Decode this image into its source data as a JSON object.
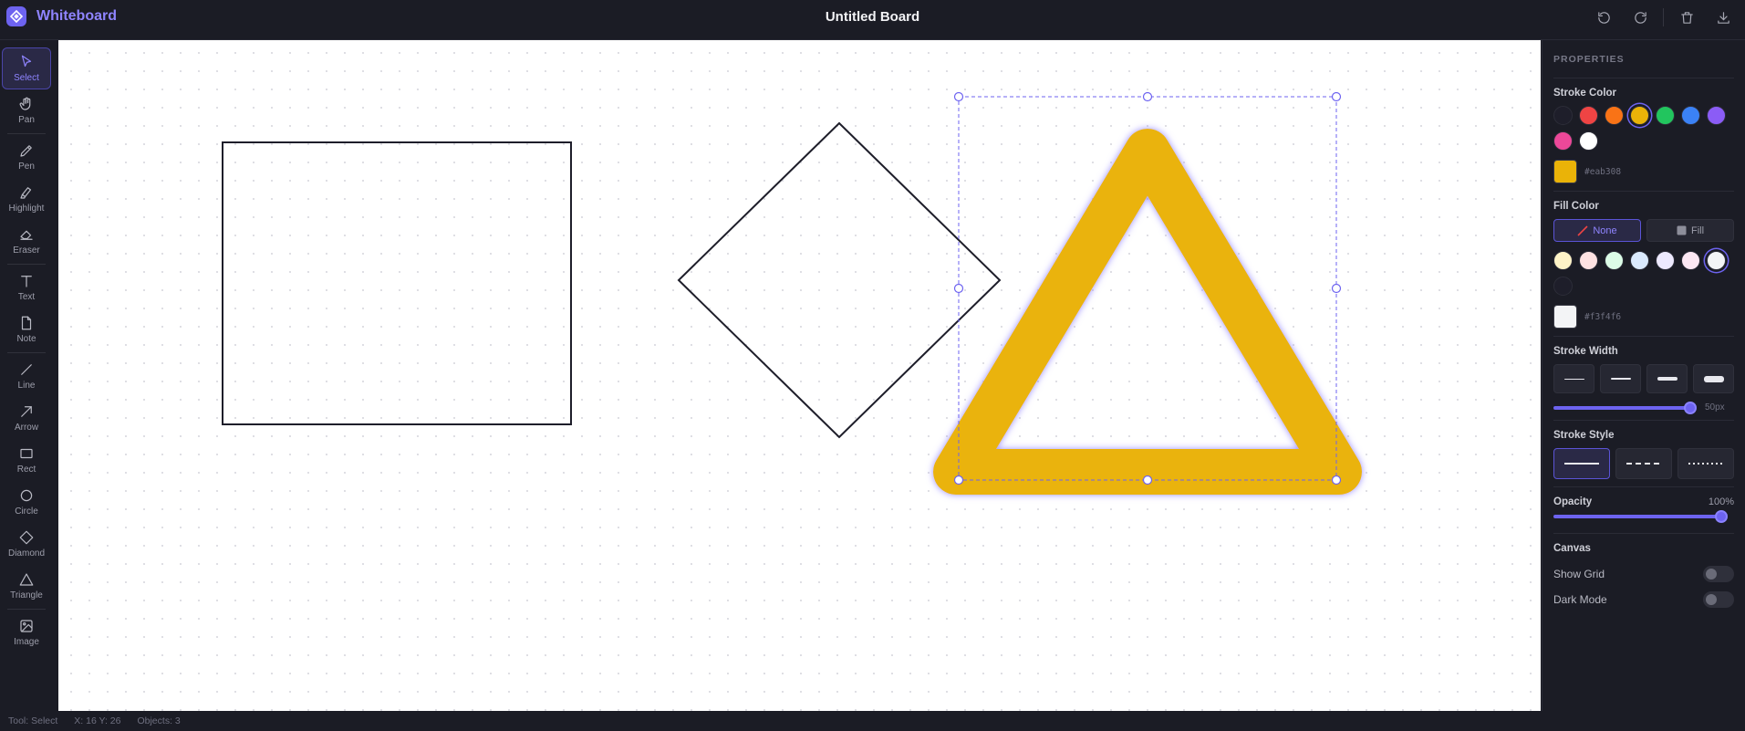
{
  "app": {
    "name": "Whiteboard"
  },
  "board": {
    "title": "Untitled Board"
  },
  "toolbar": {
    "tools": [
      {
        "label": "Select",
        "icon": "cursor-icon",
        "active": true
      },
      {
        "label": "Pan",
        "icon": "hand-icon"
      },
      {
        "label": "Pen",
        "icon": "pen-icon"
      },
      {
        "label": "Highlight",
        "icon": "highlighter-icon"
      },
      {
        "label": "Eraser",
        "icon": "eraser-icon"
      },
      {
        "label": "Text",
        "icon": "text-icon"
      },
      {
        "label": "Note",
        "icon": "note-icon"
      },
      {
        "label": "Line",
        "icon": "line-icon"
      },
      {
        "label": "Arrow",
        "icon": "arrow-icon"
      },
      {
        "label": "Rect",
        "icon": "rectangle-icon"
      },
      {
        "label": "Circle",
        "icon": "circle-icon"
      },
      {
        "label": "Diamond",
        "icon": "diamond-icon"
      },
      {
        "label": "Triangle",
        "icon": "triangle-icon"
      },
      {
        "label": "Image",
        "icon": "image-icon"
      }
    ]
  },
  "top_actions": [
    "undo-icon",
    "redo-icon",
    "trash-icon",
    "download-icon"
  ],
  "properties": {
    "heading": "PROPERTIES",
    "stroke_color": {
      "title": "Stroke Color",
      "swatches": [
        "#1e1e2a",
        "#ef4444",
        "#f97316",
        "#eab308",
        "#22c55e",
        "#3b82f6",
        "#8b5cf6",
        "#ec4899",
        "#ffffff"
      ],
      "selected": "#eab308",
      "hex": "#eab308"
    },
    "fill_color": {
      "title": "Fill Color",
      "none_label": "None",
      "fill_label": "Fill",
      "swatches": [
        "#fef3c7",
        "#fee2e2",
        "#dcfce7",
        "#dbeafe",
        "#ede9fe",
        "#fce7f3",
        "#f3f4f6",
        "#1e1e2a"
      ],
      "selected": "#f3f4f6",
      "hex": "#f3f4f6"
    },
    "stroke_width": {
      "title": "Stroke Width",
      "value_label": "50px",
      "value": 50
    },
    "stroke_style": {
      "title": "Stroke Style",
      "options": [
        "solid",
        "dashed",
        "dotted"
      ],
      "selected": "solid"
    },
    "opacity": {
      "title": "Opacity",
      "value_label": "100%",
      "value": 100
    },
    "canvas": {
      "title": "Canvas",
      "show_grid": "Show Grid",
      "dark_mode": "Dark Mode"
    }
  },
  "status": {
    "tool": "Tool: Select",
    "coords": "X: 16 Y: 26",
    "objects": "Objects: 3"
  }
}
